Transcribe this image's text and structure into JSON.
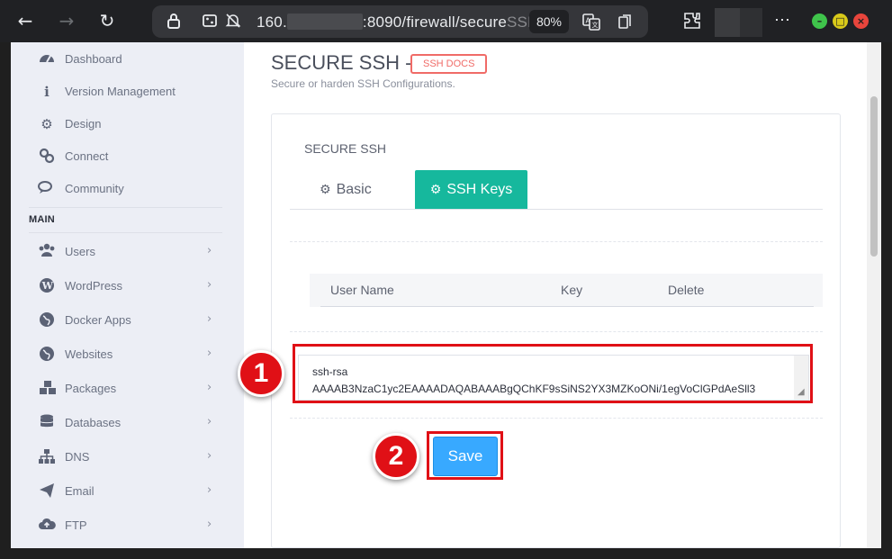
{
  "browser": {
    "back_icon": "←",
    "forward_icon": "→",
    "reload_icon": "↻",
    "url_host": "160.",
    "url_path": ":8090/firewall/secure",
    "url_fade": "SSH",
    "zoom": "80%",
    "more_icon": "⋯",
    "colors": {
      "minimize": "#3fc44b",
      "maximize": "#d8c91a",
      "close": "#e8453c"
    }
  },
  "sidebar": {
    "items_top": [
      {
        "label": "Dashboard",
        "icon": "tachometer-icon"
      },
      {
        "label": "Version Management",
        "icon": "info-icon"
      },
      {
        "label": "Design",
        "icon": "gear-icon"
      },
      {
        "label": "Connect",
        "icon": "link-icon"
      },
      {
        "label": "Community",
        "icon": "comments-icon"
      }
    ],
    "heading": "MAIN",
    "items_main": [
      {
        "label": "Users",
        "icon": "users-icon"
      },
      {
        "label": "WordPress",
        "icon": "wordpress-icon"
      },
      {
        "label": "Docker Apps",
        "icon": "globe-icon"
      },
      {
        "label": "Websites",
        "icon": "globe-icon"
      },
      {
        "label": "Packages",
        "icon": "cubes-icon"
      },
      {
        "label": "Databases",
        "icon": "database-icon"
      },
      {
        "label": "DNS",
        "icon": "sitemap-icon"
      },
      {
        "label": "Email",
        "icon": "paper-plane-icon"
      },
      {
        "label": "FTP",
        "icon": "cloud-upload-icon"
      }
    ],
    "chevron": "›"
  },
  "page": {
    "title": "SECURE SSH -",
    "docs_badge": "SSH DOCS",
    "subtitle": "Secure or harden SSH Configurations."
  },
  "card": {
    "title": "SECURE SSH",
    "tabs": [
      {
        "label": "Basic",
        "icon": "gear-icon",
        "active": false
      },
      {
        "label": "SSH Keys",
        "icon": "gears-icon",
        "active": true
      }
    ],
    "table_headers": [
      "User Name",
      "Key",
      "Delete"
    ],
    "key_value": "ssh-rsa\nAAAAB3NzaC1yc2EAAAADAQABAAABgQChKF9sSiNS2YX3MZKoONi/1egVoClGPdAeSll3",
    "save_label": "Save"
  },
  "annotations": {
    "step1": "1",
    "step2": "2",
    "color": "#e01016"
  }
}
